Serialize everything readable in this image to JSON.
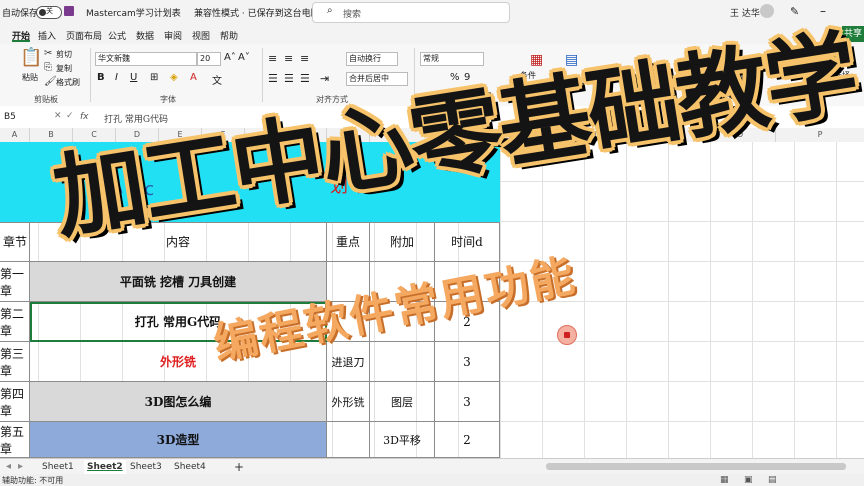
{
  "titlebar": {
    "autosave": "自动保存",
    "toggle": "关",
    "doc": "Mastercam学习计划表",
    "mode": "兼容性模式 · 已保存到这台电脑",
    "search_placeholder": "搜索",
    "user": "王 达华"
  },
  "tabs": [
    "开始",
    "插入",
    "页面布局",
    "公式",
    "数据",
    "审阅",
    "视图",
    "帮助"
  ],
  "ribbon": {
    "cut": "剪切",
    "copy": "复制",
    "format_painter": "格式刷",
    "paste": "粘贴",
    "clipboard": "剪贴板",
    "font_name": "华文新魏",
    "font_size": "20",
    "font_group": "字体",
    "wrap": "自动换行",
    "merge": "合并后居中",
    "align_group": "对齐方式",
    "number_format": "常规",
    "cond_fmt": "条件",
    "filter": "筛选",
    "select": "查找和选择",
    "delete": "删除",
    "share": "共享"
  },
  "formula": {
    "namebox": "B5",
    "fx": "fx",
    "content": "打孔 常用G代码"
  },
  "columns": [
    "A",
    "B",
    "C",
    "D",
    "E",
    "F",
    "G",
    "H",
    "I",
    "J",
    "K",
    "L",
    "M",
    "N",
    "O",
    "P"
  ],
  "table": {
    "header": [
      "章节",
      "内容",
      "重点",
      "附加",
      "时间d"
    ],
    "rows": [
      {
        "chapter": "第一章",
        "content": "平面铣 挖槽 刀具创建",
        "key": "",
        "extra": "",
        "time": ""
      },
      {
        "chapter": "第二章",
        "content": "打孔 常用G代码",
        "key": "",
        "extra": "",
        "time": "2"
      },
      {
        "chapter": "第三章",
        "content": "外形铣",
        "key": "进退刀",
        "extra": "",
        "time": "3"
      },
      {
        "chapter": "第四章",
        "content": "3D图怎么编",
        "key": "外形铣",
        "extra": "图层",
        "time": "3"
      },
      {
        "chapter": "第五章",
        "content": "3D造型",
        "key": "",
        "extra": "3D平移",
        "time": "2"
      }
    ],
    "cyan_left": "心 Mc",
    "cyan_right": "划 表"
  },
  "sheets": [
    "Sheet1",
    "Sheet2",
    "Sheet3",
    "Sheet4"
  ],
  "sheet_add": "+",
  "status": "辅助功能: 不可用",
  "overlay": {
    "title": "加工中心零基础教学",
    "subtitle": "编程软件常用功能"
  },
  "colors": {
    "accent": "#1e7d3a",
    "cyan": "#22e0f4",
    "blue": "#8eaadb",
    "title_outline": "#f6c26a",
    "subtitle": "#f4a860"
  }
}
